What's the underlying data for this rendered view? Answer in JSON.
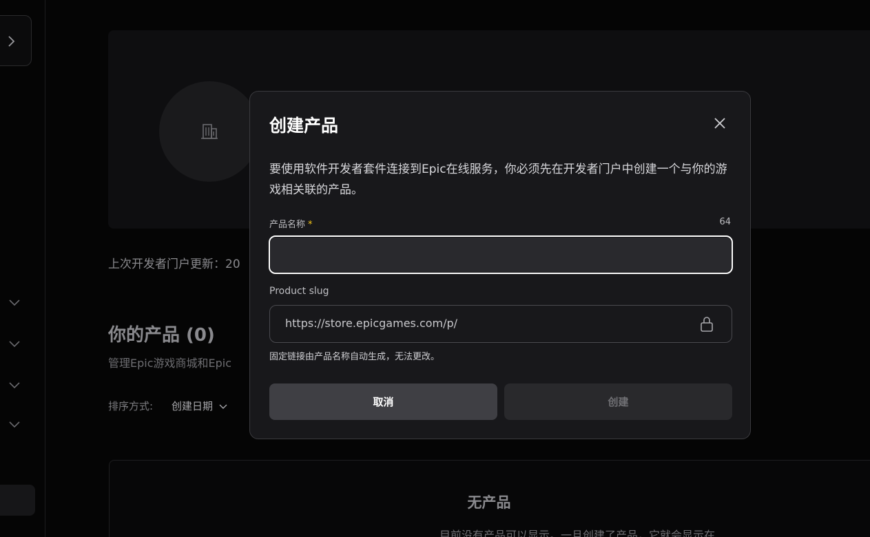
{
  "background": {
    "last_updated_text": "上次开发者门户更新：20",
    "products_title": "你的产品 (0)",
    "products_subtitle": "管理Epic游戏商城和Epic",
    "sort_label": "排序方式:",
    "sort_value": "创建日期",
    "empty_title": "无产品",
    "empty_description": "目前没有产品可以显示。一旦创建了产品，它就会显示在"
  },
  "modal": {
    "title": "创建产品",
    "description": "要使用软件开发者套件连接到Epic在线服务，你必须先在开发者门户中创建一个与你的游戏相关联的产品。",
    "name_field": {
      "label": "产品名称",
      "required_mark": "*",
      "char_count": "64",
      "value": "",
      "placeholder": ""
    },
    "slug_field": {
      "label": "Product slug",
      "value": "https://store.epicgames.com/p/",
      "help_text": "固定链接由产品名称自动生成，无法更改。"
    },
    "cancel_label": "取消",
    "create_label": "创建"
  },
  "icons": {
    "close": "close-icon",
    "lock": "lock-icon",
    "building": "building-icon",
    "chevron_right": "chevron-right-icon",
    "chevron_down": "chevron-down-icon"
  },
  "colors": {
    "modal_bg": "#18181b",
    "input_focus_border": "#ffffff",
    "required_star": "#f5c518",
    "cancel_button": "#3f3f44",
    "create_button_disabled": "#29292c"
  }
}
